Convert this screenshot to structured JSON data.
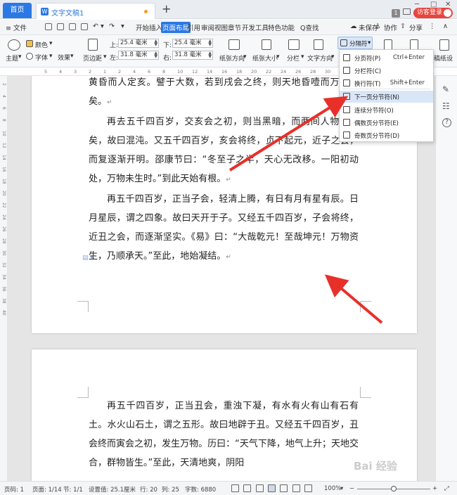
{
  "titlebar": {
    "home_tab": "首页",
    "doc_tab": "文字文稿1",
    "new_tab": "+",
    "num_badge": "1",
    "guest_login": "访客登录"
  },
  "menubar": {
    "file": "≡ 文件",
    "tabs": [
      "开始",
      "插入",
      "页面布局",
      "引用",
      "审阅",
      "视图",
      "章节",
      "开发工具",
      "特色功能"
    ],
    "active_tab": "页面布局",
    "search": "Q查找",
    "unsaved": "未保存",
    "collab": "协作",
    "share": "分享"
  },
  "ribbon": {
    "theme": "主题",
    "colors": "颜色",
    "fonts": "字体",
    "effects": "效果",
    "margins": "页边距",
    "top_label": "上:",
    "top_value": "25.4 毫米",
    "bottom_label": "下:",
    "bottom_value": "25.4 毫米",
    "left_label": "左:",
    "left_value": "31.8 毫米",
    "right_label": "右:",
    "right_value": "31.8 毫米",
    "orientation": "纸张方向",
    "size": "纸张大小",
    "columns": "分栏",
    "text_direction": "文字方向",
    "separator": "分隔符",
    "paper_dec": "稿纸设"
  },
  "ruler": {
    "ticks": [
      "5",
      "4",
      "3",
      "2",
      "1",
      "2",
      "4",
      "6",
      "8",
      "10",
      "12",
      "14",
      "16",
      "18",
      "20",
      "22",
      "24",
      "26",
      "28",
      "30",
      "32",
      "34",
      "36",
      "38"
    ]
  },
  "vruler": {
    "ticks": [
      "2",
      "4",
      "6",
      "8",
      "10",
      "12",
      "14",
      "16",
      "18",
      "20",
      "22",
      "24",
      "26",
      "28",
      "30",
      "32",
      "34",
      "36",
      "38",
      "40"
    ]
  },
  "separator_menu": {
    "items": [
      {
        "label": "分页符(P)",
        "shortcut": "Ctrl+Enter"
      },
      {
        "label": "分栏符(C)",
        "shortcut": ""
      },
      {
        "label": "换行符(T)",
        "shortcut": "Shift+Enter"
      },
      {
        "label": "下一页分节符(N)",
        "shortcut": ""
      },
      {
        "label": "连续分节符(O)",
        "shortcut": ""
      },
      {
        "label": "偶数页分节符(E)",
        "shortcut": ""
      },
      {
        "label": "奇数页分节符(D)",
        "shortcut": ""
      }
    ],
    "highlighted_index": 3
  },
  "document": {
    "page1_paragraphs": [
      "黄昏而人定亥。譬于大数，若到戌会之终，则天地昏噎而万物否矣。",
      "再去五千四百岁，交亥会之初，则当黑暗，而两间人物俱无矣，故曰混沌。又五千四百岁，亥会将终，贞下起元，近子之会，而复逐渐开明。邵康节曰：“冬至子之半，天心无改移。一阳初动处，万物未生时。”到此天始有根。",
      "再五千四百岁，正当子会，轻清上腾，有日有月有星有辰。日月星辰，谓之四象。故曰天开于子。又经五千四百岁，子会将终，近丑之会，而逐渐坚实。《易》曰：“大哉乾元！至哉坤元！万物资生，乃顺承天。”至此，地始凝结。"
    ],
    "page2_paragraphs": [
      "再五千四百岁，正当丑会，重浊下凝，有水有火有山有石有土。水火山石土，谓之五形。故曰地辟于丑。又经五千四百岁，丑会终而寅会之初，发生万物。历曰：“天气下降，地气上升；天地交合，群物皆生。”至此，天清地爽，阴阳"
    ],
    "para_mark": "↵"
  },
  "statusbar": {
    "page_num": "页码: 1",
    "page_of": "页面: 1/14",
    "section": "节: 1/1",
    "setting": "设置值: 25.1厘米",
    "row": "行: 20",
    "col": "列: 25",
    "word_count": "字数: 6880",
    "zoom": "100%",
    "zoom_level": 1.0
  },
  "watermark": "Bai 经验"
}
